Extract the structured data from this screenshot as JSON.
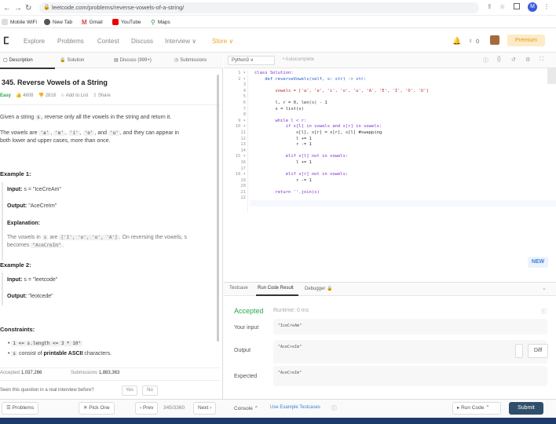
{
  "browser": {
    "url": "leetcode.com/problems/reverse-vowels-of-a-string/",
    "bookmarks": [
      "Mobile WiFi",
      "New Tab",
      "Gmail",
      "YouTube",
      "Maps"
    ],
    "profile_letter": "M"
  },
  "nav": {
    "items": [
      "Explore",
      "Problems",
      "Contest",
      "Discuss",
      "Interview ∨",
      "Store ∨"
    ],
    "streak": "0",
    "premium": "Premium"
  },
  "left_tabs": [
    "Description",
    "Solution",
    "Discuss (999+)",
    "Submissions"
  ],
  "problem": {
    "title": "345. Reverse Vowels of a String",
    "difficulty": "Easy",
    "likes": "4608",
    "dislikes": "2818",
    "add_to_list": "Add to List",
    "share": "Share",
    "desc1_pre": "Given a string",
    "desc1_code": "s",
    "desc1_post": ", reverse only all the vowels in the string and return it.",
    "desc2_pre": "The vowels are",
    "vowels": [
      "'a'",
      "'e'",
      "'i'",
      "'o'"
    ],
    "desc2_and": ", and",
    "vowel_last": "'u'",
    "desc2_post": ", and they can appear in",
    "desc2_line2": "both lower and upper cases, more than once.",
    "ex1_title": "Example 1:",
    "ex1_input_label": "Input:",
    "ex1_input": "s = \"IceCreAm\"",
    "ex1_output_label": "Output:",
    "ex1_output": "\"AceCreIm\"",
    "ex1_expl_label": "Explanation:",
    "ex1_expl_pre": "The vowels in",
    "ex1_expl_s": "s",
    "ex1_expl_are": "are",
    "ex1_expl_list": "['I', 'e', 'e', 'A']",
    "ex1_expl_post": ". On reversing the vowels, s",
    "ex1_expl_line2": "becomes",
    "ex1_expl_result": "\"AceCreIm\"",
    "ex1_expl_end": ".",
    "ex2_title": "Example 2:",
    "ex2_input_label": "Input:",
    "ex2_input": "s = \"leetcode\"",
    "ex2_output_label": "Output:",
    "ex2_output": "\"leotcede\"",
    "constraints_title": "Constraints:",
    "c1": "1 <= s.length <= 3 * 10⁵",
    "c2_code": "s",
    "c2_pre": "consist of",
    "c2_bold": "printable ASCII",
    "c2_post": "characters.",
    "accepted_label": "Accepted",
    "accepted_value": "1,037,266",
    "submissions_label": "Submissions",
    "submissions_value": "1,883,363",
    "interview_q": "Seen this question in a real interview before?",
    "yes": "Yes",
    "no": "No"
  },
  "editor": {
    "language": "Python3 ∨",
    "autocomplete": "• Autocomplete",
    "line_numbers": [
      "1 ▾",
      "2 ▾",
      "3",
      "4",
      "5",
      "6",
      "7",
      "8",
      "9 ▾",
      "10 ▾",
      "11",
      "12",
      "13",
      "14",
      "15 ▾",
      "16",
      "17",
      "18 ▾",
      "19",
      "20",
      "21",
      "22"
    ],
    "lines": [
      "class Solution:",
      "    def reverseVowels(self, s: str) -> str:",
      "",
      "        vowels = ['a', 'e', 'i', 'o', 'u', 'A', 'E', 'I', 'O', 'U']",
      "",
      "        l, r = 0, len(s) - 1",
      "        s = list(s)",
      "",
      "        while l < r:",
      "            if s[l] in vowels and s[r] in vowels:",
      "                s[l], s[r] = s[r], s[l] #swapping",
      "                l += 1",
      "                r -= 1",
      "",
      "            elif s[l] not in vowels:",
      "                l += 1",
      "",
      "            elif s[r] not in vowels:",
      "                r -= 1",
      "",
      "        return ''.join(s)",
      ""
    ],
    "new_badge": "NEW"
  },
  "console": {
    "tabs": [
      "Testcase",
      "Run Code Result",
      "Debugger"
    ],
    "status": "Accepted",
    "runtime": "Runtime: 0 ms",
    "your_input_label": "Your input",
    "your_input": "\"IceCreAm\"",
    "output_label": "Output",
    "output": "\"AceCreIm\"",
    "diff": "Diff",
    "expected_label": "Expected",
    "expected": "\"AceCreIm\""
  },
  "bottom": {
    "problems": "☰ Problems",
    "pick_one": "✕ Pick One",
    "prev": "‹ Prev",
    "page": "345/3360",
    "next": "Next ›",
    "console": "Console ⌃",
    "use_example": "Use Example Testcases",
    "run_code": "▸ Run Code ⌃",
    "submit": "Submit"
  }
}
